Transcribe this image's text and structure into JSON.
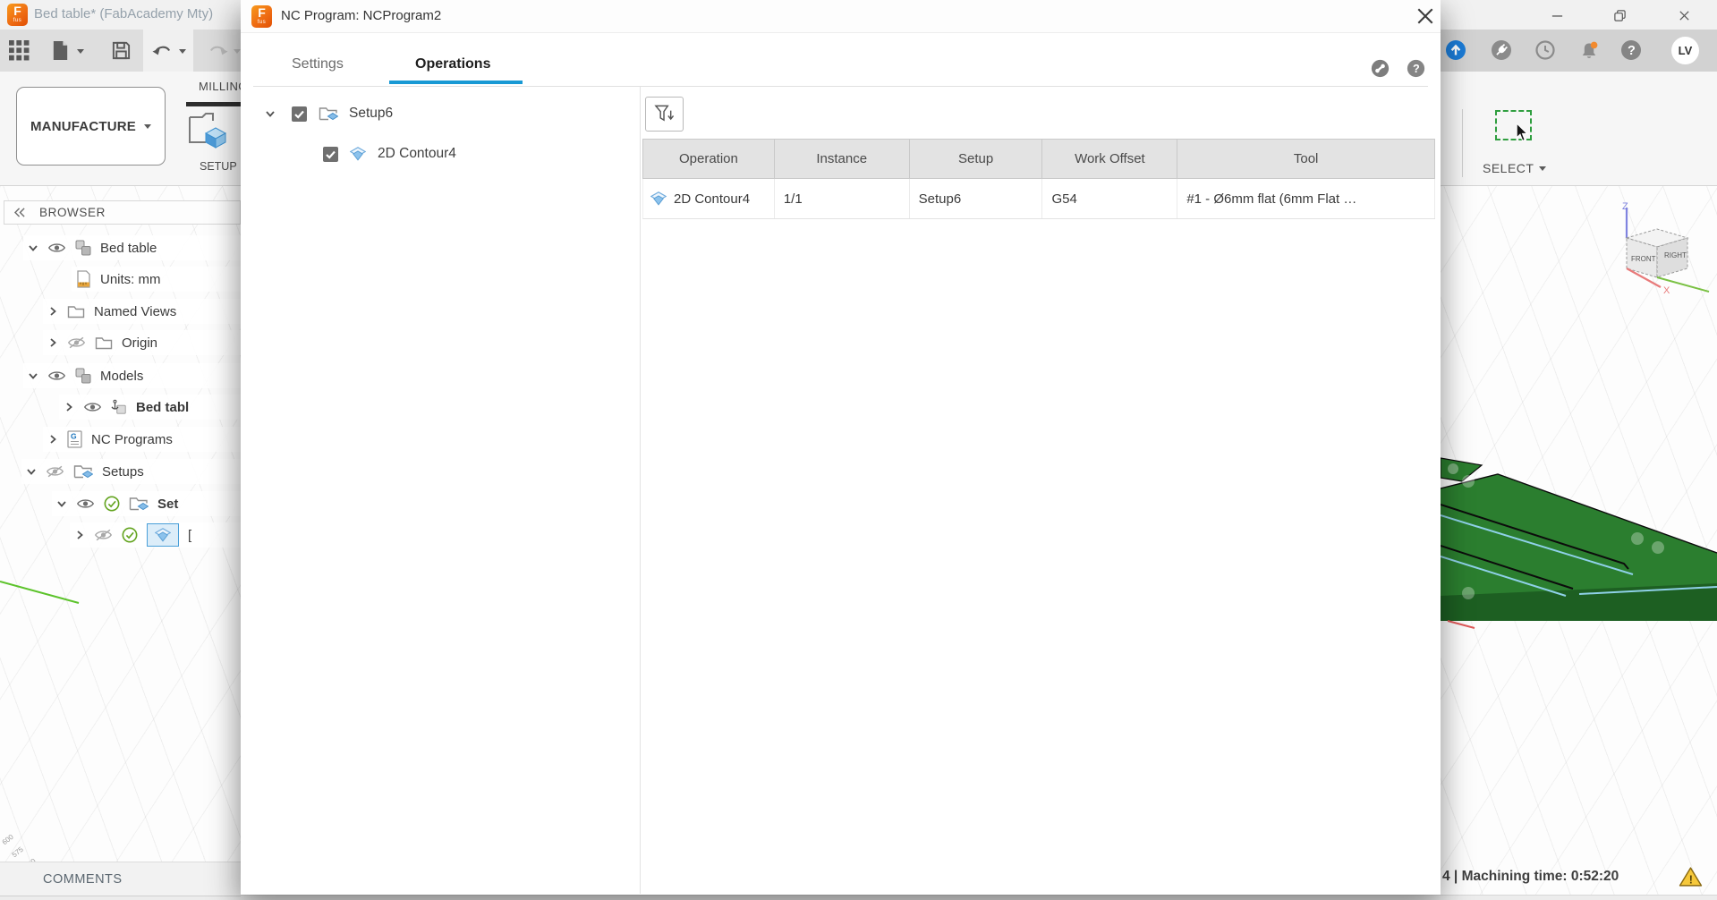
{
  "logo": {
    "letter": "F",
    "sub": "fus"
  },
  "window": {
    "title": "Bed table* (FabAcademy Mty)"
  },
  "account": {
    "avatar": "LV"
  },
  "ribbon": {
    "workspace": "MANUFACTURE",
    "tab": "MILLING",
    "setup_tool": "SETUP",
    "select_tool": "SELECT"
  },
  "browser": {
    "title": "BROWSER",
    "items": [
      {
        "label": "Bed table"
      },
      {
        "label": "Units: mm"
      },
      {
        "label": "Named Views"
      },
      {
        "label": "Origin"
      },
      {
        "label": "Models"
      },
      {
        "label": "Bed tabl"
      },
      {
        "label": "NC Programs"
      },
      {
        "label": "Setups"
      },
      {
        "label": "Set"
      },
      {
        "label": "["
      }
    ]
  },
  "comments": {
    "label": "COMMENTS"
  },
  "statusbar": {
    "text": "4 | Machining time: 0:52:20"
  },
  "viewcube": {
    "front": "FRONT",
    "right": "RIGHT",
    "axis_z": "Z",
    "axis_x": "X"
  },
  "canvas_labels": [
    "600",
    "575",
    "600"
  ],
  "dialog": {
    "title": "NC Program: NCProgram2",
    "tabs": {
      "settings": "Settings",
      "operations": "Operations"
    },
    "tree": {
      "setup": "Setup6",
      "operation": "2D Contour4"
    },
    "table": {
      "columns": [
        "Operation",
        "Instance",
        "Setup",
        "Work Offset",
        "Tool"
      ],
      "row": {
        "operation": "2D Contour4",
        "instance": "1/1",
        "setup": "Setup6",
        "work_offset": "G54",
        "tool": "#1 - Ø6mm flat (6mm Flat …"
      }
    }
  },
  "colors": {
    "accent": "#1899d4",
    "fusion_orange": "#ef6d13",
    "check_green": "#63a41f",
    "model_green": "#2b7e2f",
    "warning": "#f6c83b"
  }
}
